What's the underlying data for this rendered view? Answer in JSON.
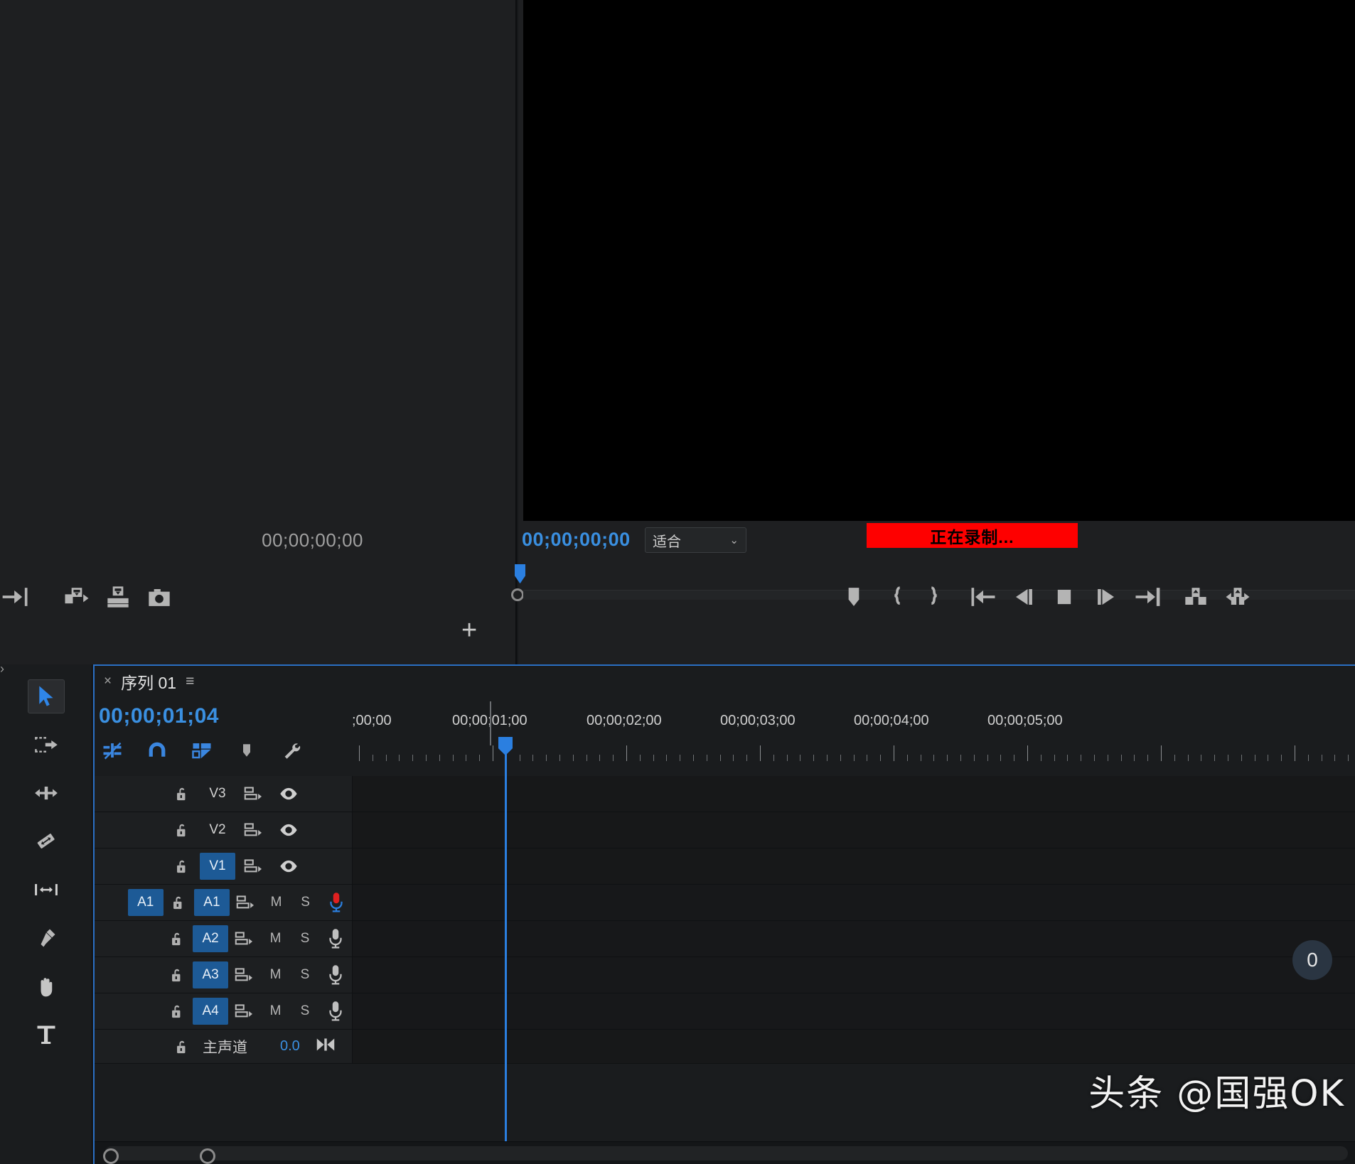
{
  "source_monitor": {
    "timecode": "00;00;00;00",
    "toolbar_icons": [
      "go-to-out-point-icon",
      "insert-icon",
      "overwrite-icon",
      "export-frame-icon"
    ],
    "add_button_label": "+"
  },
  "program_monitor": {
    "timecode": "00;00;00;00",
    "zoom_level": "适合",
    "zoom_chevron": "⌄",
    "recording_banner": "正在录制...",
    "recording_color": "#fe0000",
    "transport_icons": [
      "add-marker-icon",
      "mark-in-icon",
      "mark-out-icon",
      "go-to-in-point-icon",
      "step-back-icon",
      "stop-icon",
      "step-forward-icon",
      "go-to-out-point-icon",
      "lift-icon",
      "extract-icon"
    ]
  },
  "tools": {
    "items": [
      {
        "name": "selection-tool",
        "active": true
      },
      {
        "name": "track-select-forward-tool",
        "active": false
      },
      {
        "name": "ripple-edit-tool",
        "active": false
      },
      {
        "name": "razor-tool",
        "active": false
      },
      {
        "name": "slip-tool",
        "active": false
      },
      {
        "name": "pen-tool",
        "active": false
      },
      {
        "name": "hand-tool",
        "active": false
      },
      {
        "name": "type-tool",
        "active": false
      }
    ]
  },
  "timeline": {
    "tab_close": "×",
    "tab_title": "序列 01",
    "tab_menu": "≡",
    "playhead_timecode": "00;00;01;04",
    "toolbar_icons": [
      "insert-overwrite-toggle-icon",
      "snap-icon",
      "linked-selection-icon",
      "add-marker-icon",
      "timeline-settings-icon"
    ],
    "ruler_labels": [
      ";00;00",
      "00;00;01;00",
      "00;00;02;00",
      "00;00;03;00",
      "00;00;04;00",
      "00;00;05;00"
    ],
    "video_tracks": [
      {
        "name": "V3",
        "targeted": false
      },
      {
        "name": "V2",
        "targeted": false
      },
      {
        "name": "V1",
        "targeted": true
      }
    ],
    "audio_tracks": [
      {
        "name": "A1",
        "patch": "A1",
        "patched": true,
        "targeted": true,
        "mute": "M",
        "solo": "S",
        "armed": true
      },
      {
        "name": "A2",
        "patch": "",
        "patched": false,
        "targeted": true,
        "mute": "M",
        "solo": "S",
        "armed": false
      },
      {
        "name": "A3",
        "patch": "",
        "patched": false,
        "targeted": true,
        "mute": "M",
        "solo": "S",
        "armed": false
      },
      {
        "name": "A4",
        "patch": "",
        "patched": false,
        "targeted": true,
        "mute": "M",
        "solo": "S",
        "armed": false
      }
    ],
    "master_track": {
      "name": "主声道",
      "value": "0.0"
    },
    "keyframe_badge": "0"
  },
  "watermark": "头条 @国强OK",
  "colors": {
    "accent_blue": "#2b7fe0",
    "track_blue": "#1d5a96",
    "record_red": "#fe0000",
    "panel_bg": "#1a1c1e",
    "monitor_bg": "#1e1f21"
  }
}
